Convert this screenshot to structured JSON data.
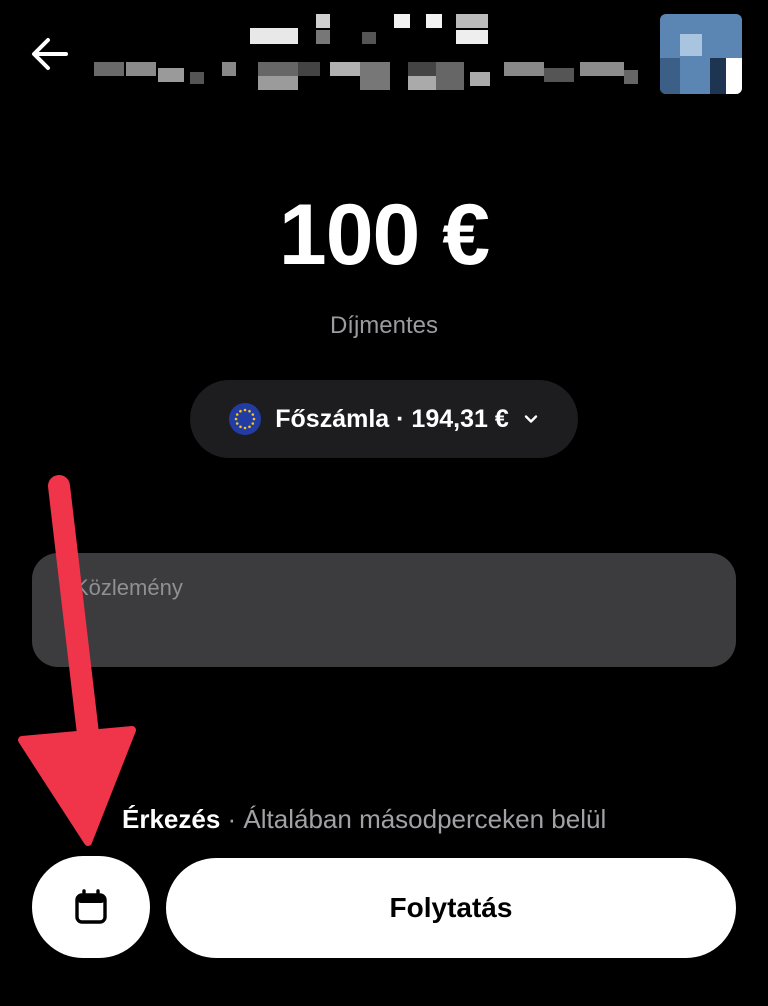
{
  "header": {
    "back_icon": "arrow-left-icon",
    "avatar_icon": "avatar"
  },
  "transfer": {
    "amount": "100 €",
    "fee_label": "Díjmentes"
  },
  "account": {
    "flag_icon": "eu-flag-icon",
    "label": "Főszámla · 194,31 €",
    "chevron_icon": "chevron-down-icon"
  },
  "message": {
    "placeholder": "Közlemény",
    "value": ""
  },
  "arrival": {
    "label": "Érkezés",
    "separator": " · ",
    "detail": "Általában másodperceken belül"
  },
  "actions": {
    "calendar_icon": "calendar-icon",
    "continue_label": "Folytatás"
  },
  "colors": {
    "background": "#000000",
    "pill": "#1d1d20",
    "input": "#3c3c3f",
    "secondary_text": "#9b9ba0",
    "annotation": "#f0344a"
  }
}
